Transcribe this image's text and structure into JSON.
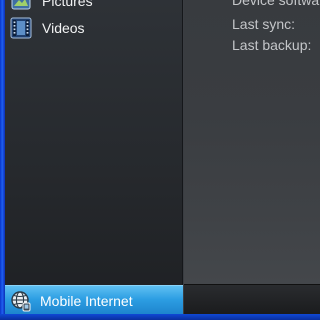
{
  "nav": {
    "items": [
      {
        "label": "Pictures",
        "icon": "pictures-icon"
      },
      {
        "label": "Videos",
        "icon": "videos-icon"
      }
    ],
    "selected": {
      "label": "Mobile Internet",
      "icon": "globe-icon"
    }
  },
  "device_info": {
    "device_software_label": "Device software",
    "last_sync_label": "Last sync:",
    "last_backup_label": "Last backup:"
  },
  "colors": {
    "frame_blue": "#1f5ff0",
    "selected_blue": "#2d9ee3",
    "pane_dark": "#2e3237",
    "text_light": "#f2f3f4"
  }
}
